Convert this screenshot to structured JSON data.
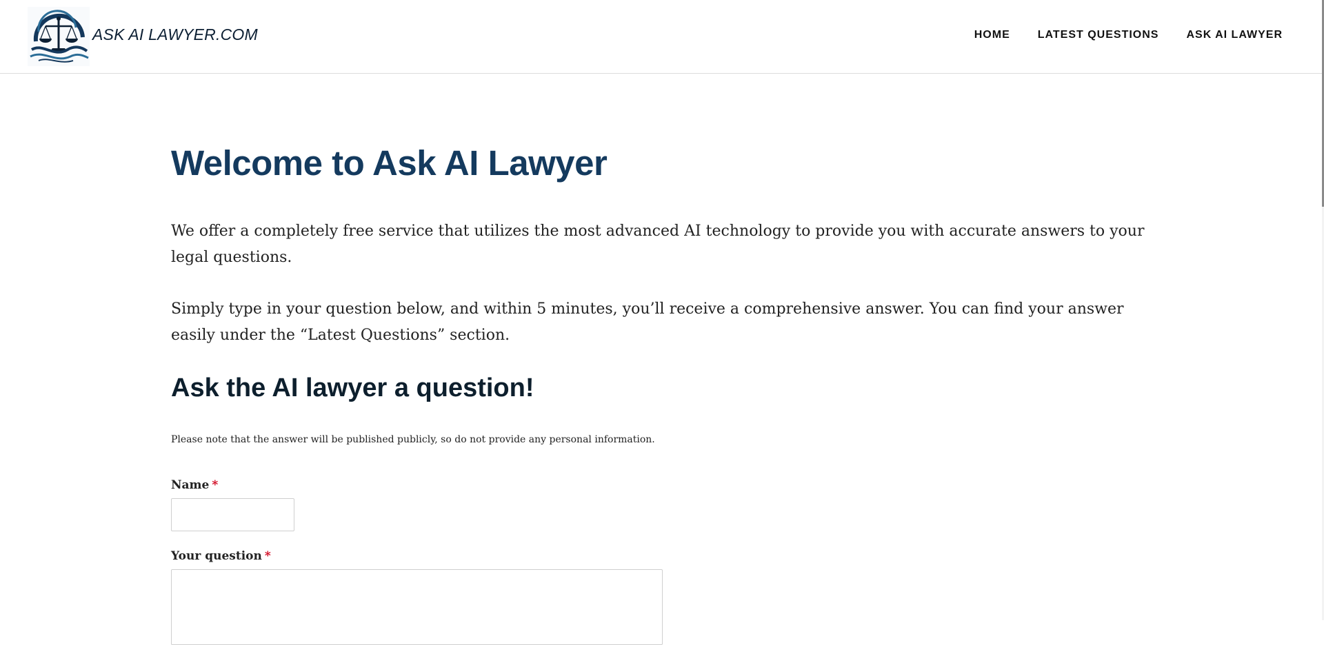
{
  "header": {
    "logo_text": "ASK AI LAWYER.COM",
    "nav": [
      {
        "label": "HOME"
      },
      {
        "label": "LATEST QUESTIONS"
      },
      {
        "label": "ASK AI LAWYER"
      }
    ]
  },
  "main": {
    "title": "Welcome to Ask AI Lawyer",
    "paragraphs": [
      "We offer a completely free service that utilizes the most advanced AI technology to provide you with accurate answers to your legal questions.",
      "Simply type in your question below, and within 5 minutes, you’ll receive a comprehensive answer. You can find your answer easily under the “Latest Questions” section."
    ],
    "form": {
      "heading": "Ask the AI lawyer a question!",
      "note": "Please note that the answer will be published publicly, so do not provide any personal information.",
      "name_label": "Name",
      "question_label": "Your question",
      "required_mark": "*",
      "name_value": "",
      "question_value": ""
    }
  },
  "colors": {
    "title": "#143a5e",
    "heading": "#0d1f2d",
    "required": "#d0021b",
    "logo_navy": "#14385c"
  },
  "icons": {
    "logo": "scales-of-justice-logo"
  }
}
